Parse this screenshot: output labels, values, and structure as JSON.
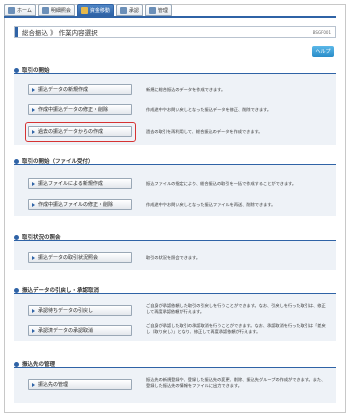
{
  "tabs": [
    {
      "label": "ホーム",
      "active": false,
      "icon": "home-icon"
    },
    {
      "label": "明細照会",
      "active": false,
      "icon": "document-icon"
    },
    {
      "label": "資金移動",
      "active": true,
      "icon": "transfer-icon"
    },
    {
      "label": "承認",
      "active": false,
      "icon": "check-icon"
    },
    {
      "label": "管理",
      "active": false,
      "icon": "admin-icon"
    }
  ],
  "header": {
    "title": "総合振込 》 作業内容選択",
    "screen_id": "BSGF001"
  },
  "help_label": "ヘルプ",
  "sections": [
    {
      "title": "取引の開始",
      "items": [
        {
          "button": "振込データの新規作成",
          "desc": "新規に総合振込のデータを作成できます。"
        },
        {
          "button": "作成中振込データの修正・削除",
          "desc": "作成途中やお問い戻しとなった振込データを修正、削除できます。"
        },
        {
          "button": "過去の振込データからの作成",
          "desc": "過去の取引を再利用して、総合振込のデータを作成できます。"
        }
      ]
    },
    {
      "title": "取引の開始（ファイル受付）",
      "items": [
        {
          "button": "振込ファイルによる新規作成",
          "desc": "振込ファイルの指定により、総合振込の取引を一括で作成することができます。"
        },
        {
          "button": "作成中振込ファイルの修正・削除",
          "desc": "作成途中やお問い戻しとなった振込ファイルを再送、削除できます。"
        }
      ]
    },
    {
      "title": "取引状況の照会",
      "items": [
        {
          "button": "振込データの取引状況照会",
          "desc": "取引の状況を照会できます。"
        }
      ]
    },
    {
      "title": "振込データの引戻し・承認取消",
      "items": [
        {
          "button": "承認待ちデータの引戻し",
          "desc": "ご自身が承認依頼した取引の引戻しを行うことができます。なお、引戻しを行った取引は、修正して再度承認依頼が行えます。"
        },
        {
          "button": "承認済データの承認取消",
          "desc": "ご自身が承認した取引の承認取消を行うことができます。なお、承認取消を行った取引は「差戻し（取り戻し）」となり、修正して再度承認依頼が行えます。"
        }
      ]
    },
    {
      "title": "振込先の管理",
      "items": [
        {
          "button": "振込先の管理",
          "desc": "振込先の新規登録や、登録した振込先の変更、削除、振込先グループの作成ができます。また、登録した振込先の情報をファイルに出力できます。"
        }
      ]
    }
  ],
  "colors": {
    "accent": "#2f63a6",
    "highlight": "#d63333",
    "section_bg": "#eef2f7"
  }
}
